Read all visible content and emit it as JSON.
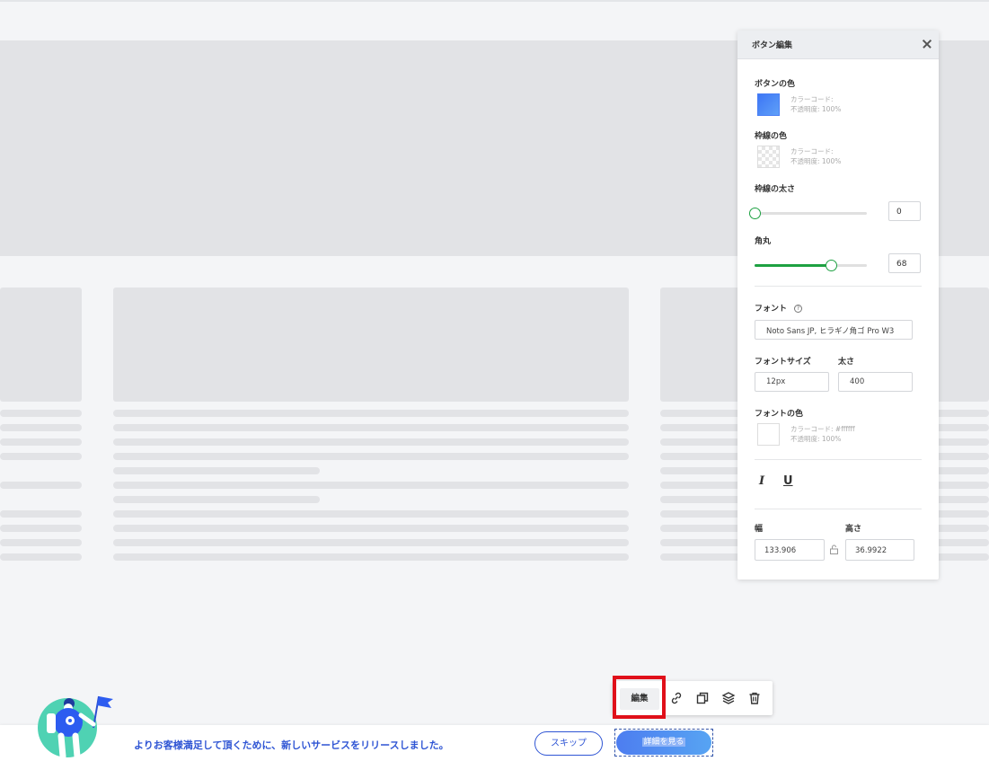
{
  "panel": {
    "title": "ボタン編集",
    "button_color": {
      "label": "ボタンの色",
      "color": "#4a7ff5",
      "code_label": "カラーコード:",
      "opacity": "不透明度: 100%"
    },
    "border_color": {
      "label": "枠線の色",
      "code_label": "カラーコード:",
      "opacity": "不透明度: 100%"
    },
    "border_width": {
      "label": "枠線の太さ",
      "value": "0",
      "fraction": 0.0
    },
    "corner_radius": {
      "label": "角丸",
      "value": "68",
      "fraction": 0.68
    },
    "font": {
      "label": "フォント",
      "help": "?",
      "value": "Noto Sans JP, ヒラギノ角ゴ Pro W3"
    },
    "font_size": {
      "label": "フォントサイズ",
      "value": "12px"
    },
    "font_weight": {
      "label": "太さ",
      "value": "400"
    },
    "font_color": {
      "label": "フォントの色",
      "color": "#ffffff",
      "code_label": "カラーコード: #ffffff",
      "opacity": "不透明度: 100%"
    },
    "style_icons": {
      "italic": "I",
      "underline": "U"
    },
    "width": {
      "label": "幅",
      "value": "133.906"
    },
    "height": {
      "label": "高さ",
      "value": "36.9922"
    }
  },
  "toolbar": {
    "edit_label": "編集",
    "icons": [
      "link-icon",
      "duplicate-icon",
      "layers-icon",
      "trash-icon"
    ]
  },
  "banner": {
    "message": "よりお客様満足して頂くために、新しいサービスをリリースしました。",
    "skip_label": "スキップ",
    "detail_label": "詳細を見る",
    "accent": "#2f55d4"
  }
}
